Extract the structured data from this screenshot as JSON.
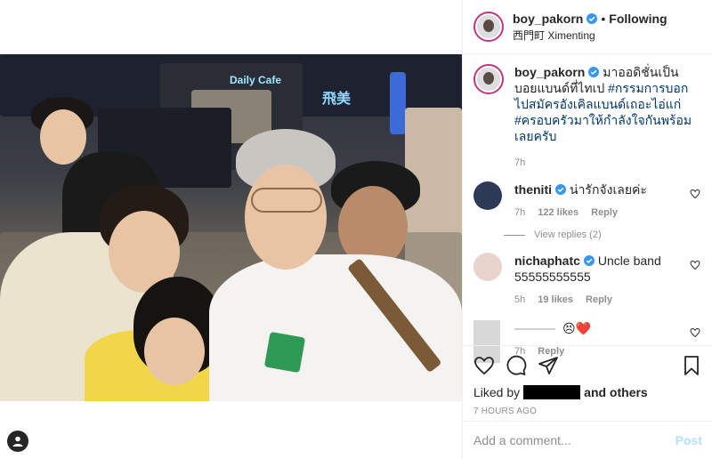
{
  "post": {
    "username": "boy_pakorn",
    "follow_status": "Following",
    "separator": "•",
    "location": "西門町 Ximenting",
    "photo_signs": [
      "Daily Cafe",
      "飛美"
    ]
  },
  "caption": {
    "username": "boy_pakorn",
    "text_plain": " มาออดิชั่นเป็นบอยแบนด์ที่ไทเป ",
    "hashtag1": "#กรรมการบอกไปสมัครอังเคิลแบนด์เถอะไอ่แก่",
    "hashtag2": "#ครอบครัวมาให้กำลังใจกันพร้อมเลยครับ",
    "time": "7h"
  },
  "comments": [
    {
      "username": "theniti",
      "text": "น่ารักจังเลยค่ะ",
      "time": "7h",
      "likes": "122 likes",
      "reply": "Reply",
      "view_replies": "View replies (2)"
    },
    {
      "username": "nichaphatc",
      "text": "Uncle band 55555555555",
      "time": "5h",
      "likes": "19 likes",
      "reply": "Reply"
    },
    {
      "username": "",
      "text": "😣❤️",
      "time": "7h",
      "reply": "Reply"
    }
  ],
  "actions": {
    "liked_prefix": "Liked by",
    "liked_suffix": "and others",
    "timestamp": "7 HOURS AGO"
  },
  "add_comment": {
    "placeholder": "Add a comment...",
    "post_label": "Post"
  },
  "icons": [
    "verified-icon",
    "heart-icon",
    "comment-icon",
    "share-icon",
    "save-icon",
    "user-icon"
  ],
  "colors": {
    "verified": "#3897f0",
    "link": "#00376b",
    "muted": "#8e8e8e",
    "post_button_disabled": "#b2dffc",
    "heart_red": "#ed4956"
  }
}
